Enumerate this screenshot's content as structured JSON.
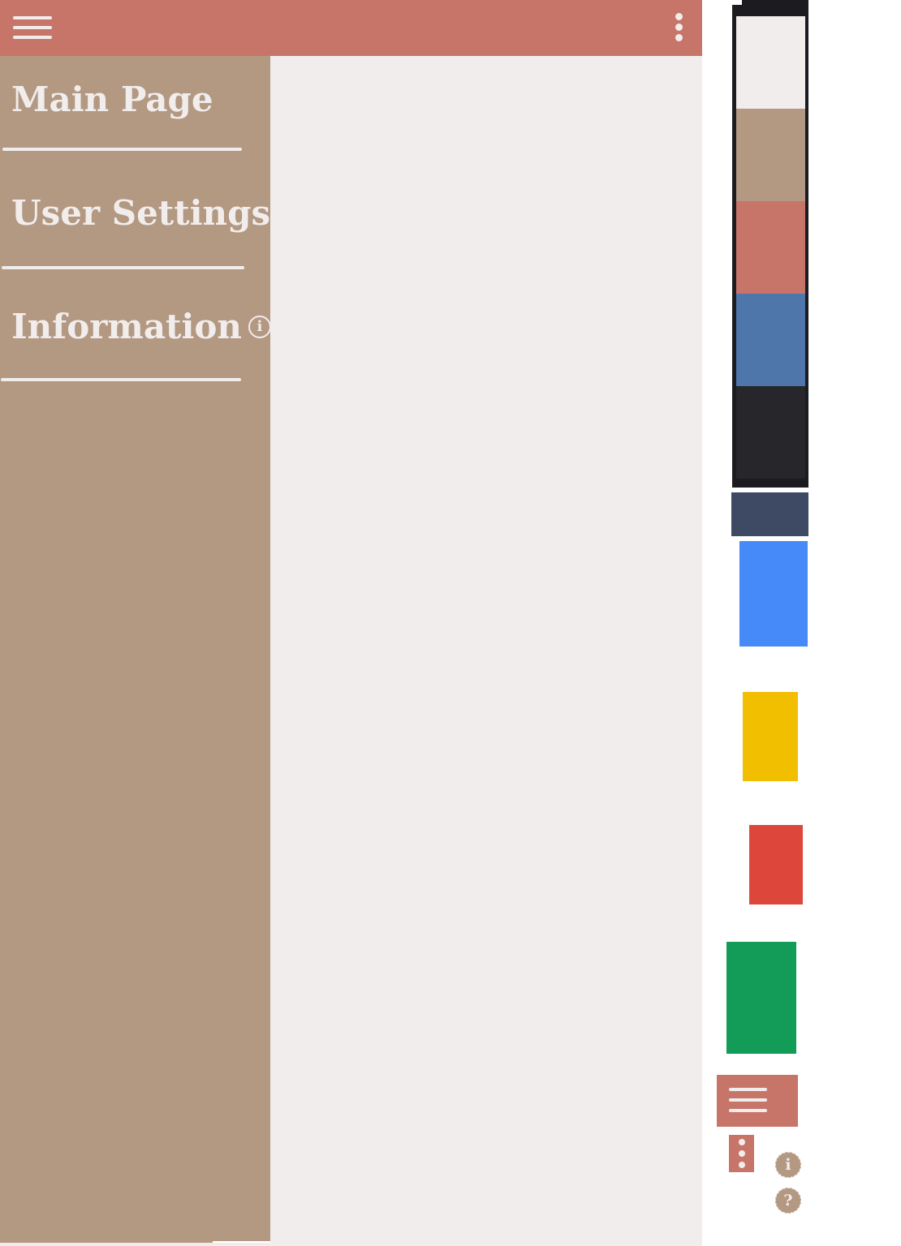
{
  "colors": {
    "light": "#f1edec",
    "tan": "#b39882",
    "salmon": "#c87569",
    "blue": "#4f76ab",
    "dark": "#26262b",
    "slate": "#3e4a63",
    "google_blue": "#4689f8",
    "google_yellow": "#f2be00",
    "google_red": "#dd473b",
    "google_green": "#129c57"
  },
  "topbar": {
    "menu_icon": "hamburger-icon",
    "overflow_icon": "more-vert-icon"
  },
  "drawer": {
    "items": [
      {
        "label": "Main Page"
      },
      {
        "label": "User Settings"
      },
      {
        "label": "Information",
        "icon": "info-icon",
        "icon_glyph": "i"
      }
    ]
  },
  "palette": {
    "swatches": [
      "#f1edec",
      "#b39882",
      "#c87569",
      "#4f76ab",
      "#26262b"
    ],
    "blocks": [
      "#3e4a63",
      "#4689f8",
      "#f2be00",
      "#dd473b",
      "#129c57"
    ]
  },
  "mini_icons": {
    "info_glyph": "i",
    "help_glyph": "?"
  }
}
